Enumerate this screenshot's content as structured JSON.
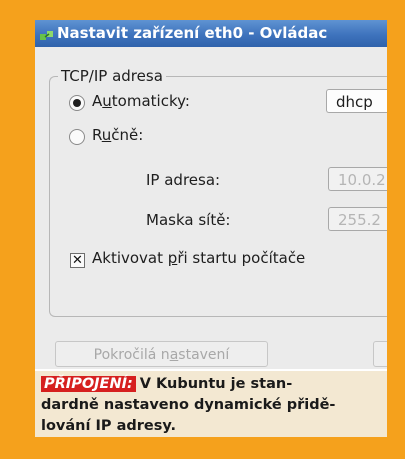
{
  "window": {
    "title": "Nastavit zařízení eth0 - Ovládac",
    "icon": "network-icon"
  },
  "group": {
    "legend": "TCP/IP adresa"
  },
  "auto_option": {
    "label_pre": "A",
    "label_ul": "u",
    "label_post": "tomaticky:",
    "selected": true,
    "method_value": "dhcp"
  },
  "manual_option": {
    "label_pre": "R",
    "label_ul": "u",
    "label_post": "čně:",
    "selected": false
  },
  "ip": {
    "label": "IP adresa:",
    "value": "10.0.2"
  },
  "mask": {
    "label": "Maska sítě:",
    "value": "255.2"
  },
  "startup": {
    "label_pre": "Aktivovat ",
    "label_ul": "p",
    "label_post": "ři startu počítače",
    "checked": true
  },
  "buttons": {
    "advanced_pre": "Pokročilá n",
    "advanced_ul": "a",
    "advanced_post": "stavení"
  },
  "caption": {
    "tag": "PŘIPOJENÍ:",
    "text_line1": "V Kubuntu je stan-",
    "text_line2": "dardně nastaveno dynamické přidě-",
    "text_line3": "lování IP adresy."
  },
  "colors": {
    "page_background": "#f5a11c",
    "titlebar": "#3e73bd",
    "caption_tag": "#d6201f"
  }
}
